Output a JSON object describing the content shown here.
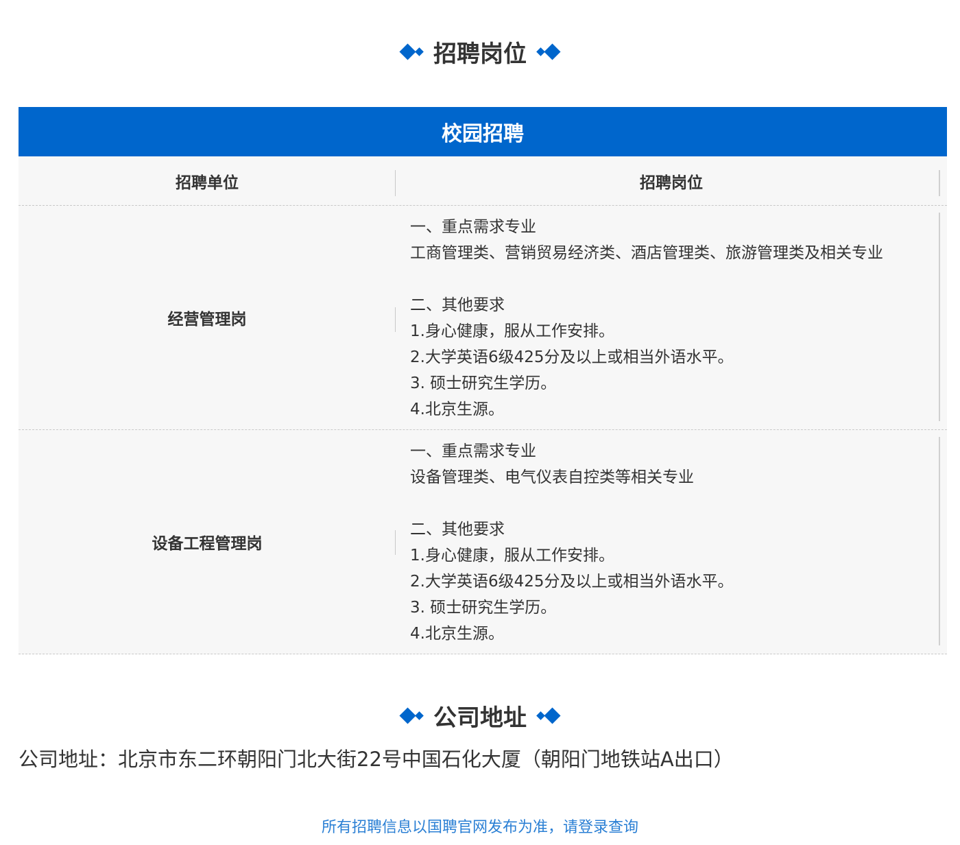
{
  "section_positions": {
    "title": "招聘岗位"
  },
  "table": {
    "banner": "校园招聘",
    "header": {
      "unit": "招聘单位",
      "position": "招聘岗位"
    },
    "rows": [
      {
        "unit": "经营管理岗",
        "lines": [
          "一、重点需求专业",
          "工商管理类、营销贸易经济类、酒店管理类、旅游管理类及相关专业",
          "",
          "二、其他要求",
          "1.身心健康，服从工作安排。",
          "2.大学英语6级425分及以上或相当外语水平。",
          "3. 硕士研究生学历。",
          "4.北京生源。"
        ]
      },
      {
        "unit": "设备工程管理岗",
        "lines": [
          "一、重点需求专业",
          "设备管理类、电气仪表自控类等相关专业",
          "",
          "二、其他要求",
          "1.身心健康，服从工作安排。",
          "2.大学英语6级425分及以上或相当外语水平。",
          "3. 硕士研究生学历。",
          "4.北京生源。"
        ]
      }
    ]
  },
  "section_address": {
    "title": "公司地址",
    "text": "公司地址：北京市东二环朝阳门北大街22号中国石化大厦（朝阳门地铁站A出口）"
  },
  "footer": {
    "note": "所有招聘信息以国聘官网发布为准，请登录查询"
  },
  "colors": {
    "accent": "#0066cc",
    "link": "#2a7fd4"
  }
}
